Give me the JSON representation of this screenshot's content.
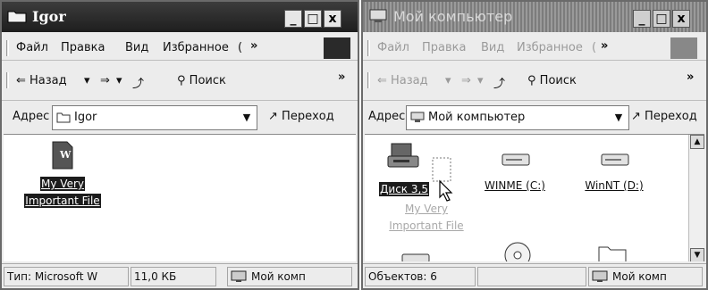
{
  "window_igor": {
    "title": "Igor",
    "menu": [
      "Файл",
      "Правка",
      "Вид",
      "Избранное",
      "("
    ],
    "toolbar": {
      "back": "Назад",
      "search": "Поиск"
    },
    "address": {
      "label": "Адрес",
      "value": "Igor",
      "go": "Переход"
    },
    "items": [
      {
        "label_line1": "My Very",
        "label_line2": "Important File"
      }
    ],
    "status": {
      "type": "Тип: Microsoft W",
      "size": "11,0 КБ",
      "zone": "Мой комп"
    }
  },
  "window_pc": {
    "title": "Мой компьютер",
    "menu": [
      "Файл",
      "Правка",
      "Вид",
      "Избранное",
      "("
    ],
    "toolbar": {
      "back": "Назад",
      "search": "Поиск"
    },
    "address": {
      "label": "Адрес",
      "value": "Мой компьютер",
      "go": "Переход"
    },
    "items": [
      {
        "label": "Диск 3,5"
      },
      {
        "label": "WINME (C:)"
      },
      {
        "label": "WinNT (D:)"
      }
    ],
    "drag_ghost": {
      "line1": "My Very",
      "line2": "Important File"
    },
    "status": {
      "objects": "Объектов: 6",
      "zone": "Мой комп"
    }
  },
  "caption_buttons": {
    "minimize": "_",
    "maximize": "□",
    "close": "x"
  },
  "icons": {
    "folder": "folder-icon",
    "document": "word-document-icon",
    "computer": "my-computer-icon",
    "floppy": "floppy-drive-icon",
    "hdd": "hard-drive-icon",
    "cd": "cd-drive-icon",
    "cursor": "drag-cursor-icon",
    "search": "magnifier-icon"
  }
}
